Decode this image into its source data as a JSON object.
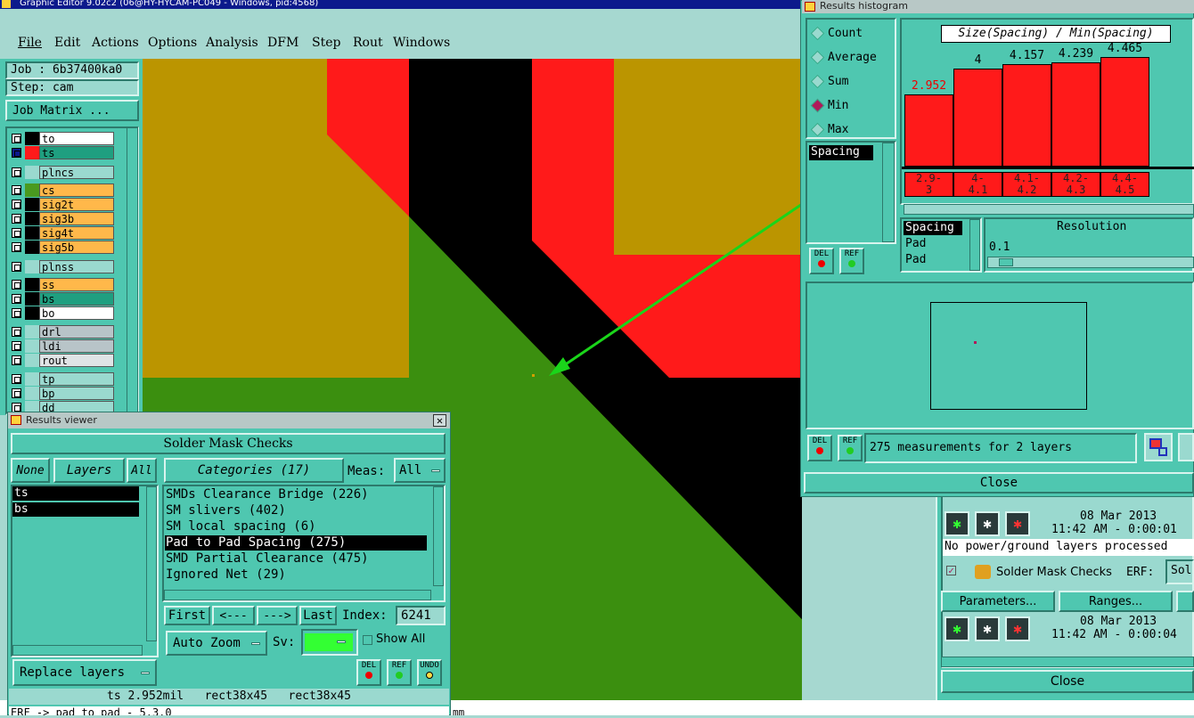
{
  "app": {
    "title": "Graphic Editor 9.02c2 (06@HY-HYCAM-PC049 - Windows, pid:4568)"
  },
  "menu": [
    "File",
    "Edit",
    "Actions",
    "Options",
    "Analysis",
    "DFM",
    "Step",
    "Rout",
    "Windows"
  ],
  "job": {
    "job": "Job : 6b37400ka0",
    "step": "Step: cam",
    "matrix_btn": "Job Matrix ..."
  },
  "layers": [
    {
      "name": "to",
      "color": "#000000",
      "fill": "#ffffff"
    },
    {
      "name": "ts",
      "color": "#ff1a1a",
      "fill": "#1f9f80"
    },
    {
      "name": "plncs",
      "color": "#9ad9cf",
      "fill": "#9ad9cf"
    },
    {
      "name": "cs",
      "color": "#4a9a20",
      "fill": "#ffb84a"
    },
    {
      "name": "sig2t",
      "color": "#000000",
      "fill": "#ffb84a"
    },
    {
      "name": "sig3b",
      "color": "#000000",
      "fill": "#ffb84a"
    },
    {
      "name": "sig4t",
      "color": "#000000",
      "fill": "#ffb84a"
    },
    {
      "name": "sig5b",
      "color": "#000000",
      "fill": "#ffb84a"
    },
    {
      "name": "plnss",
      "color": "#9ad9cf",
      "fill": "#9ad9cf"
    },
    {
      "name": "ss",
      "color": "#000000",
      "fill": "#ffb84a"
    },
    {
      "name": "bs",
      "color": "#000000",
      "fill": "#1f9f80"
    },
    {
      "name": "bo",
      "color": "#000000",
      "fill": "#ffffff"
    },
    {
      "name": "drl",
      "color": "#9ad9cf",
      "fill": "#b8c4c8"
    },
    {
      "name": "ldi",
      "color": "#9ad9cf",
      "fill": "#b8c4c8"
    },
    {
      "name": "rout",
      "color": "#9ad9cf",
      "fill": "#dfe4e6"
    },
    {
      "name": "tp",
      "color": "#9ad9cf",
      "fill": "#9ad9cf"
    },
    {
      "name": "bp",
      "color": "#9ad9cf",
      "fill": "#9ad9cf"
    },
    {
      "name": "dd",
      "color": "#9ad9cf",
      "fill": "#9ad9cf"
    }
  ],
  "results_viewer": {
    "title": "Results viewer",
    "header": "Solder Mask Checks",
    "none_btn": "None",
    "layers_btn": "Layers",
    "all_btn": "All",
    "categories_btn": "Categories (17)",
    "meas_label": "Meas:",
    "meas_value": "All",
    "layer_list": [
      "ts",
      "bs"
    ],
    "categories": [
      "SMDs Clearance Bridge (226)",
      "SM slivers (402)",
      "SM local spacing (6)",
      "Pad to Pad Spacing (275)",
      "SMD Partial Clearance (475)",
      "Ignored Net (29)"
    ],
    "selected_category": "Pad to Pad Spacing (275)",
    "nav": {
      "first": "First",
      "prev": "<---",
      "next": "--->",
      "last": "Last",
      "index_label": "Index:",
      "index_value": "6241"
    },
    "zoom": "Auto Zoom",
    "sv_label": "Sv:",
    "show_all": "Show All",
    "replace": "Replace layers",
    "del": "DEL",
    "ref": "REF",
    "undo": "UNDO",
    "status": "ts 2.952mil   rect38x45   rect38x45",
    "bottom_text": "ERF -> pad to pad - 5.3.0"
  },
  "histogram": {
    "title": "Results histogram",
    "radios": [
      "Count",
      "Average",
      "Sum",
      "Min",
      "Max"
    ],
    "selected_radio": "Min",
    "chart_title": "Size(Spacing) / Min(Spacing)",
    "list1": [
      "Spacing"
    ],
    "list2": [
      "Spacing",
      "Pad",
      "Pad"
    ],
    "resolution_label": "Resolution",
    "resolution_value": "0.1",
    "measurements": "275 measurements for 2 layers",
    "close": "Close",
    "del": "DEL",
    "ref": "REF"
  },
  "chart_data": {
    "type": "bar",
    "title": "Size(Spacing) / Min(Spacing)",
    "categories": [
      "2.9-3",
      "4-4.1",
      "4.1-4.2",
      "4.2-4.3",
      "4.4-4.5"
    ],
    "bin_labels": [
      [
        "2.9-",
        "3"
      ],
      [
        "4-",
        "4.1"
      ],
      [
        "4.1-",
        "4.2"
      ],
      [
        "4.2-",
        "4.3"
      ],
      [
        "4.4-",
        "4.5"
      ]
    ],
    "values": [
      2.952,
      4,
      4.157,
      4.239,
      4.465
    ],
    "value_labels": [
      "2.952",
      "4",
      "4.157",
      "4.239",
      "4.465"
    ]
  },
  "right_panel": {
    "date1": "08 Mar 2013",
    "time1": "11:42 AM - 0:00:01",
    "message": "No power/ground layers processed",
    "check_name": "Solder Mask Checks",
    "erf_label": "ERF:",
    "erf_value": "Sol",
    "params_btn": "Parameters...",
    "ranges_btn": "Ranges...",
    "date2": "08 Mar 2013",
    "time2": "11:42 AM - 0:00:04",
    "close": "Close",
    "partial1": "Parameters",
    "partial2": "Ranges"
  },
  "bottom_status": "mm"
}
